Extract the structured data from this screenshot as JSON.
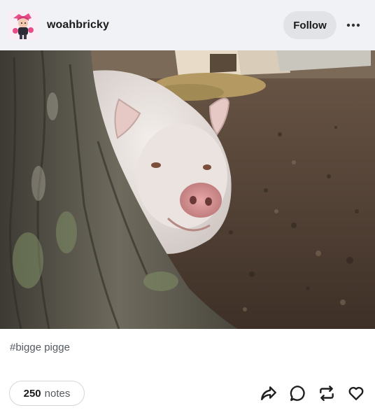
{
  "post": {
    "username": "woahbricky",
    "follow_label": "Follow",
    "more_icon": "ellipsis-icon",
    "photo_alt": "",
    "tags": [
      "#bigge pigge"
    ],
    "notes": {
      "count": "250",
      "label": "notes"
    },
    "actions": [
      {
        "name": "share",
        "icon": "share-icon"
      },
      {
        "name": "reply",
        "icon": "reply-icon"
      },
      {
        "name": "reblog",
        "icon": "reblog-icon"
      },
      {
        "name": "like",
        "icon": "heart-icon"
      }
    ]
  },
  "colors": {
    "header_bg": "#f0f2f5",
    "follow_bg": "#e1e3e7",
    "tag_text": "#555a61",
    "notes_border": "#d3d6db"
  }
}
